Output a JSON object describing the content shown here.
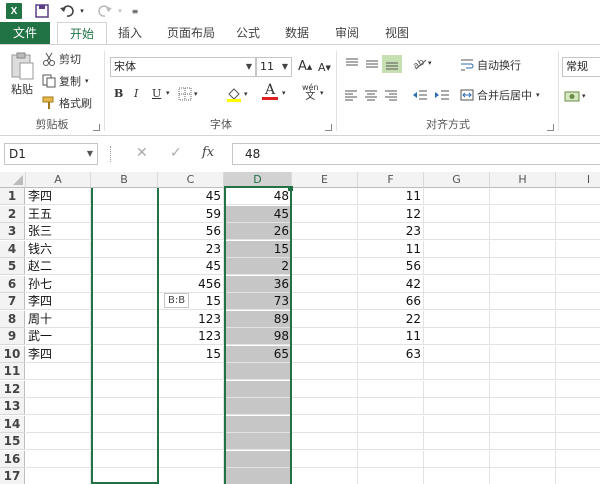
{
  "qat": {
    "logo": "X",
    "undo_icon": "undo-icon",
    "redo_icon": "redo-icon"
  },
  "tabs": [
    "文件",
    "开始",
    "插入",
    "页面布局",
    "公式",
    "数据",
    "审阅",
    "视图"
  ],
  "ribbon": {
    "clipboard": {
      "paste": "粘贴",
      "cut": "剪切",
      "copy": "复制",
      "format_painter": "格式刷",
      "label": "剪贴板"
    },
    "font": {
      "font_name": "宋体",
      "font_size": "11",
      "bold": "B",
      "italic": "I",
      "underline": "U",
      "font_color_letter": "A",
      "label": "字体",
      "phonetic": "wén"
    },
    "alignment": {
      "wrap_text": "自动换行",
      "merge_center": "合并后居中",
      "label": "对齐方式"
    },
    "number": {
      "format": "常规"
    }
  },
  "formula_bar": {
    "name_box": "D1",
    "fx": "fx",
    "value": "48"
  },
  "columns": [
    "A",
    "B",
    "C",
    "D",
    "E",
    "F",
    "G",
    "H",
    "I"
  ],
  "rows": [
    {
      "n": "1",
      "a": "李四",
      "c": "45",
      "d": "48",
      "f": "11"
    },
    {
      "n": "2",
      "a": "王五",
      "c": "59",
      "d": "45",
      "f": "12"
    },
    {
      "n": "3",
      "a": "张三",
      "c": "56",
      "d": "26",
      "f": "23"
    },
    {
      "n": "4",
      "a": "钱六",
      "c": "23",
      "d": "15",
      "f": "11"
    },
    {
      "n": "5",
      "a": "赵二",
      "c": "45",
      "d": "2",
      "f": "56"
    },
    {
      "n": "6",
      "a": "孙七",
      "c": "456",
      "d": "36",
      "f": "42"
    },
    {
      "n": "7",
      "a": "李四",
      "c": "15",
      "d": "73",
      "f": "66"
    },
    {
      "n": "8",
      "a": "周十",
      "c": "123",
      "d": "89",
      "f": "22"
    },
    {
      "n": "9",
      "a": "武一",
      "c": "123",
      "d": "98",
      "f": "11"
    },
    {
      "n": "10",
      "a": "李四",
      "c": "15",
      "d": "65",
      "f": "63"
    },
    {
      "n": "11"
    },
    {
      "n": "12"
    },
    {
      "n": "13"
    },
    {
      "n": "14"
    },
    {
      "n": "15"
    },
    {
      "n": "16"
    },
    {
      "n": "17"
    },
    {
      "n": "18"
    }
  ],
  "drag_tooltip": "B:B",
  "colors": {
    "accent": "#217346",
    "selection_fill": "#c6c6c6",
    "header_bg": "#f3f3f3"
  }
}
